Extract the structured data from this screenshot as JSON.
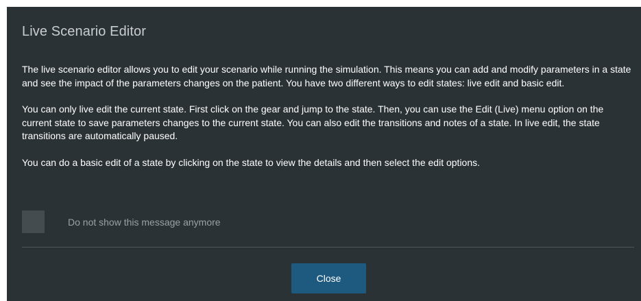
{
  "dialog": {
    "title": "Live Scenario Editor",
    "paragraphs": [
      "The live scenario editor allows you to edit your scenario while running the simulation. This means you can add and modify parameters in a state and see the impact of the parameters changes on the patient. You have two different ways to edit states: live edit and basic edit.",
      "You can only live edit the current state. First click on the gear and jump to the state. Then, you can use the Edit (Live) menu option on the current state to save parameters changes to the current state. You can also edit the transitions and notes of a state. In live edit, the state transitions are automatically paused.",
      "You can do a basic edit of a state by clicking on the state to view the details and then select the edit options."
    ],
    "checkbox": {
      "label": "Do not show this message anymore",
      "checked": false
    },
    "close_label": "Close"
  },
  "colors": {
    "dialog_background": "#2b3236",
    "title_text": "#c9cdd0",
    "checkbox_fill": "#454c50",
    "checkbox_label": "#9aa0a4",
    "button_background": "#1e5a80"
  }
}
